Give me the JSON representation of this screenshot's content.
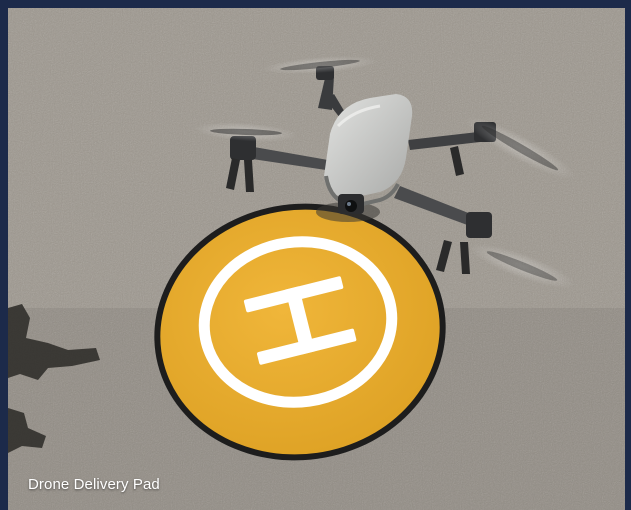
{
  "caption": "Drone Delivery Pad",
  "colors": {
    "frame": "#1c2a4a",
    "pad": "#e8ac2c",
    "pad_ring": "#1f1f1f",
    "marking": "#ffffff",
    "drone_body": "#c9cac8",
    "ground": "#9b958c"
  },
  "image": {
    "subject": "drone above landing pad",
    "icons": [
      "helipad-h-icon"
    ]
  }
}
